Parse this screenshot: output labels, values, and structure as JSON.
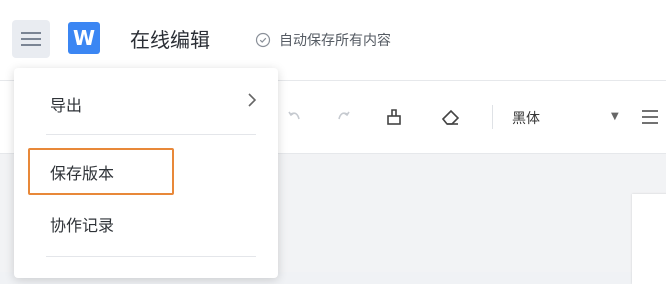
{
  "header": {
    "app_title": "在线编辑",
    "save_status": "自动保存所有内容",
    "logo_letter": "W",
    "logo_color": "#3b86f3"
  },
  "toolbar": {
    "font_name": "黑体"
  },
  "menu": {
    "items": [
      {
        "label": "导出",
        "has_submenu": true
      },
      {
        "label": "保存版本",
        "highlighted": true
      },
      {
        "label": "协作记录"
      }
    ],
    "highlight_color": "#e88839"
  },
  "icons": {
    "menu": "hamburger-menu-icon",
    "status": "clock-icon",
    "undo": "undo-icon",
    "redo": "redo-icon",
    "format_painter": "format-painter-icon",
    "eraser": "eraser-icon",
    "dropdown": "caret-down-icon",
    "align": "align-icon",
    "submenu": "chevron-right-icon"
  }
}
